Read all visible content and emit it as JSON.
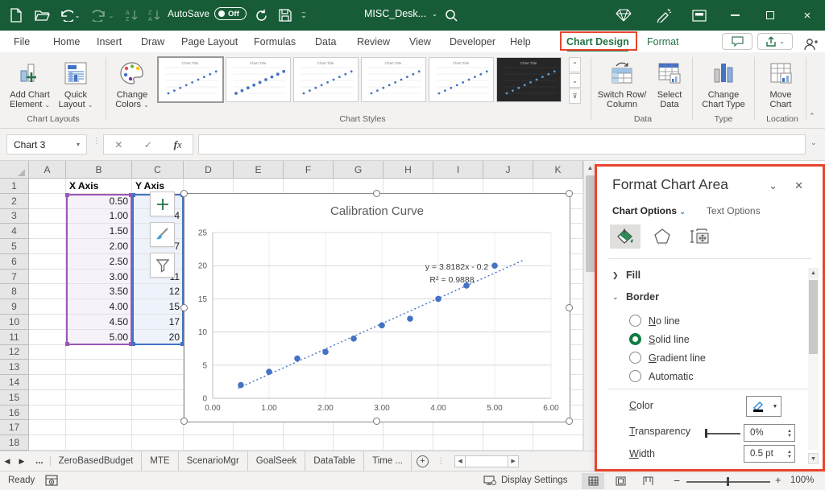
{
  "colors": {
    "titlebar_green": "#185C37",
    "accent_green": "#217346",
    "highlight_red": "#E8442E",
    "point_blue": "#4472C4",
    "range_purple": "#9B57B6",
    "range_blue": "#4472C4"
  },
  "titlebar": {
    "autosave_label": "AutoSave",
    "autosave_state": "Off",
    "filename": "MISC_Desk..."
  },
  "ribbon_tabs": [
    {
      "label": "File"
    },
    {
      "label": "Home"
    },
    {
      "label": "Insert"
    },
    {
      "label": "Draw"
    },
    {
      "label": "Page Layout"
    },
    {
      "label": "Formulas"
    },
    {
      "label": "Data"
    },
    {
      "label": "Review"
    },
    {
      "label": "View"
    },
    {
      "label": "Developer"
    },
    {
      "label": "Help"
    },
    {
      "label": "Chart Design",
      "active": true,
      "highlighted": true
    },
    {
      "label": "Format",
      "green": true
    }
  ],
  "ribbon": {
    "buttons": {
      "add_chart_element": [
        "Add Chart",
        "Element"
      ],
      "quick_layout": [
        "Quick",
        "Layout"
      ],
      "change_colors": [
        "Change",
        "Colors"
      ],
      "switch_row_column": [
        "Switch Row/",
        "Column"
      ],
      "select_data": [
        "Select",
        "Data"
      ],
      "change_chart_type": [
        "Change",
        "Chart Type"
      ],
      "move_chart": [
        "Move",
        "Chart"
      ]
    },
    "groups": {
      "chart_layouts": "Chart Layouts",
      "chart_styles": "Chart Styles",
      "data": "Data",
      "type": "Type",
      "location": "Location"
    },
    "style_thumbs": [
      "style-1",
      "style-2",
      "style-3",
      "style-4",
      "style-5",
      "style-6-dark"
    ]
  },
  "formula_bar": {
    "name_box": "Chart 3",
    "formula": ""
  },
  "grid": {
    "column_headers": [
      "A",
      "B",
      "C",
      "D",
      "E",
      "F",
      "G",
      "H",
      "I",
      "J",
      "K"
    ],
    "row_count": 18,
    "header_cells": {
      "B1": "X Axis",
      "C1": "Y Axis"
    },
    "x_values": [
      "0.50",
      "1.00",
      "1.50",
      "2.00",
      "2.50",
      "3.00",
      "3.50",
      "4.00",
      "4.50",
      "5.00"
    ],
    "y_values_visible": [
      "",
      "4",
      "",
      "7",
      "",
      "11",
      "12",
      "15",
      "17",
      "20"
    ]
  },
  "chart_buttons": [
    "chart-elements-plus",
    "chart-styles-brush",
    "chart-filters-funnel"
  ],
  "chart_data": {
    "type": "scatter",
    "title": "Calibration Curve",
    "x": [
      0.5,
      1.0,
      1.5,
      2.0,
      2.5,
      3.0,
      3.5,
      4.0,
      4.5,
      5.0
    ],
    "y": [
      2,
      4,
      6,
      7,
      9,
      11,
      12,
      15,
      17,
      20
    ],
    "xlim": [
      0,
      6
    ],
    "ylim": [
      0,
      25
    ],
    "x_ticks": [
      "0.00",
      "1.00",
      "2.00",
      "3.00",
      "4.00",
      "5.00",
      "6.00"
    ],
    "y_ticks": [
      "0",
      "5",
      "10",
      "15",
      "20",
      "25"
    ],
    "trendline": {
      "slope": 3.8182,
      "intercept": -0.2,
      "equation": "y = 3.8182x - 0.2",
      "r_squared": "R² = 0.9888",
      "style": "dotted",
      "x_start": 0.45,
      "x_end": 5.5
    },
    "grid": true,
    "legend": "none",
    "point_color": "#4472C4"
  },
  "format_panel": {
    "title": "Format Chart Area",
    "tab_chart_options": "Chart Options",
    "tab_text_options": "Text Options",
    "section_fill": "Fill",
    "section_border": "Border",
    "border_options": [
      {
        "label": "No line",
        "accel": "N",
        "selected": false
      },
      {
        "label": "Solid line",
        "accel": "S",
        "selected": true
      },
      {
        "label": "Gradient line",
        "accel": "G",
        "selected": false
      },
      {
        "label": "Automatic",
        "accel": "",
        "selected": false
      }
    ],
    "color_label": "Color",
    "color_accel": "C",
    "transparency_label": "Transparency",
    "transparency_accel": "T",
    "transparency_value": "0%",
    "width_label": "Width",
    "width_accel": "W",
    "width_value": "0.5 pt"
  },
  "sheet_bar": {
    "overflow": "...",
    "tabs": [
      "ZeroBasedBudget",
      "MTE",
      "ScenarioMgr",
      "GoalSeek",
      "DataTable",
      "Time ..."
    ]
  },
  "status_bar": {
    "ready": "Ready",
    "display_settings": "Display Settings",
    "zoom": "100%"
  }
}
